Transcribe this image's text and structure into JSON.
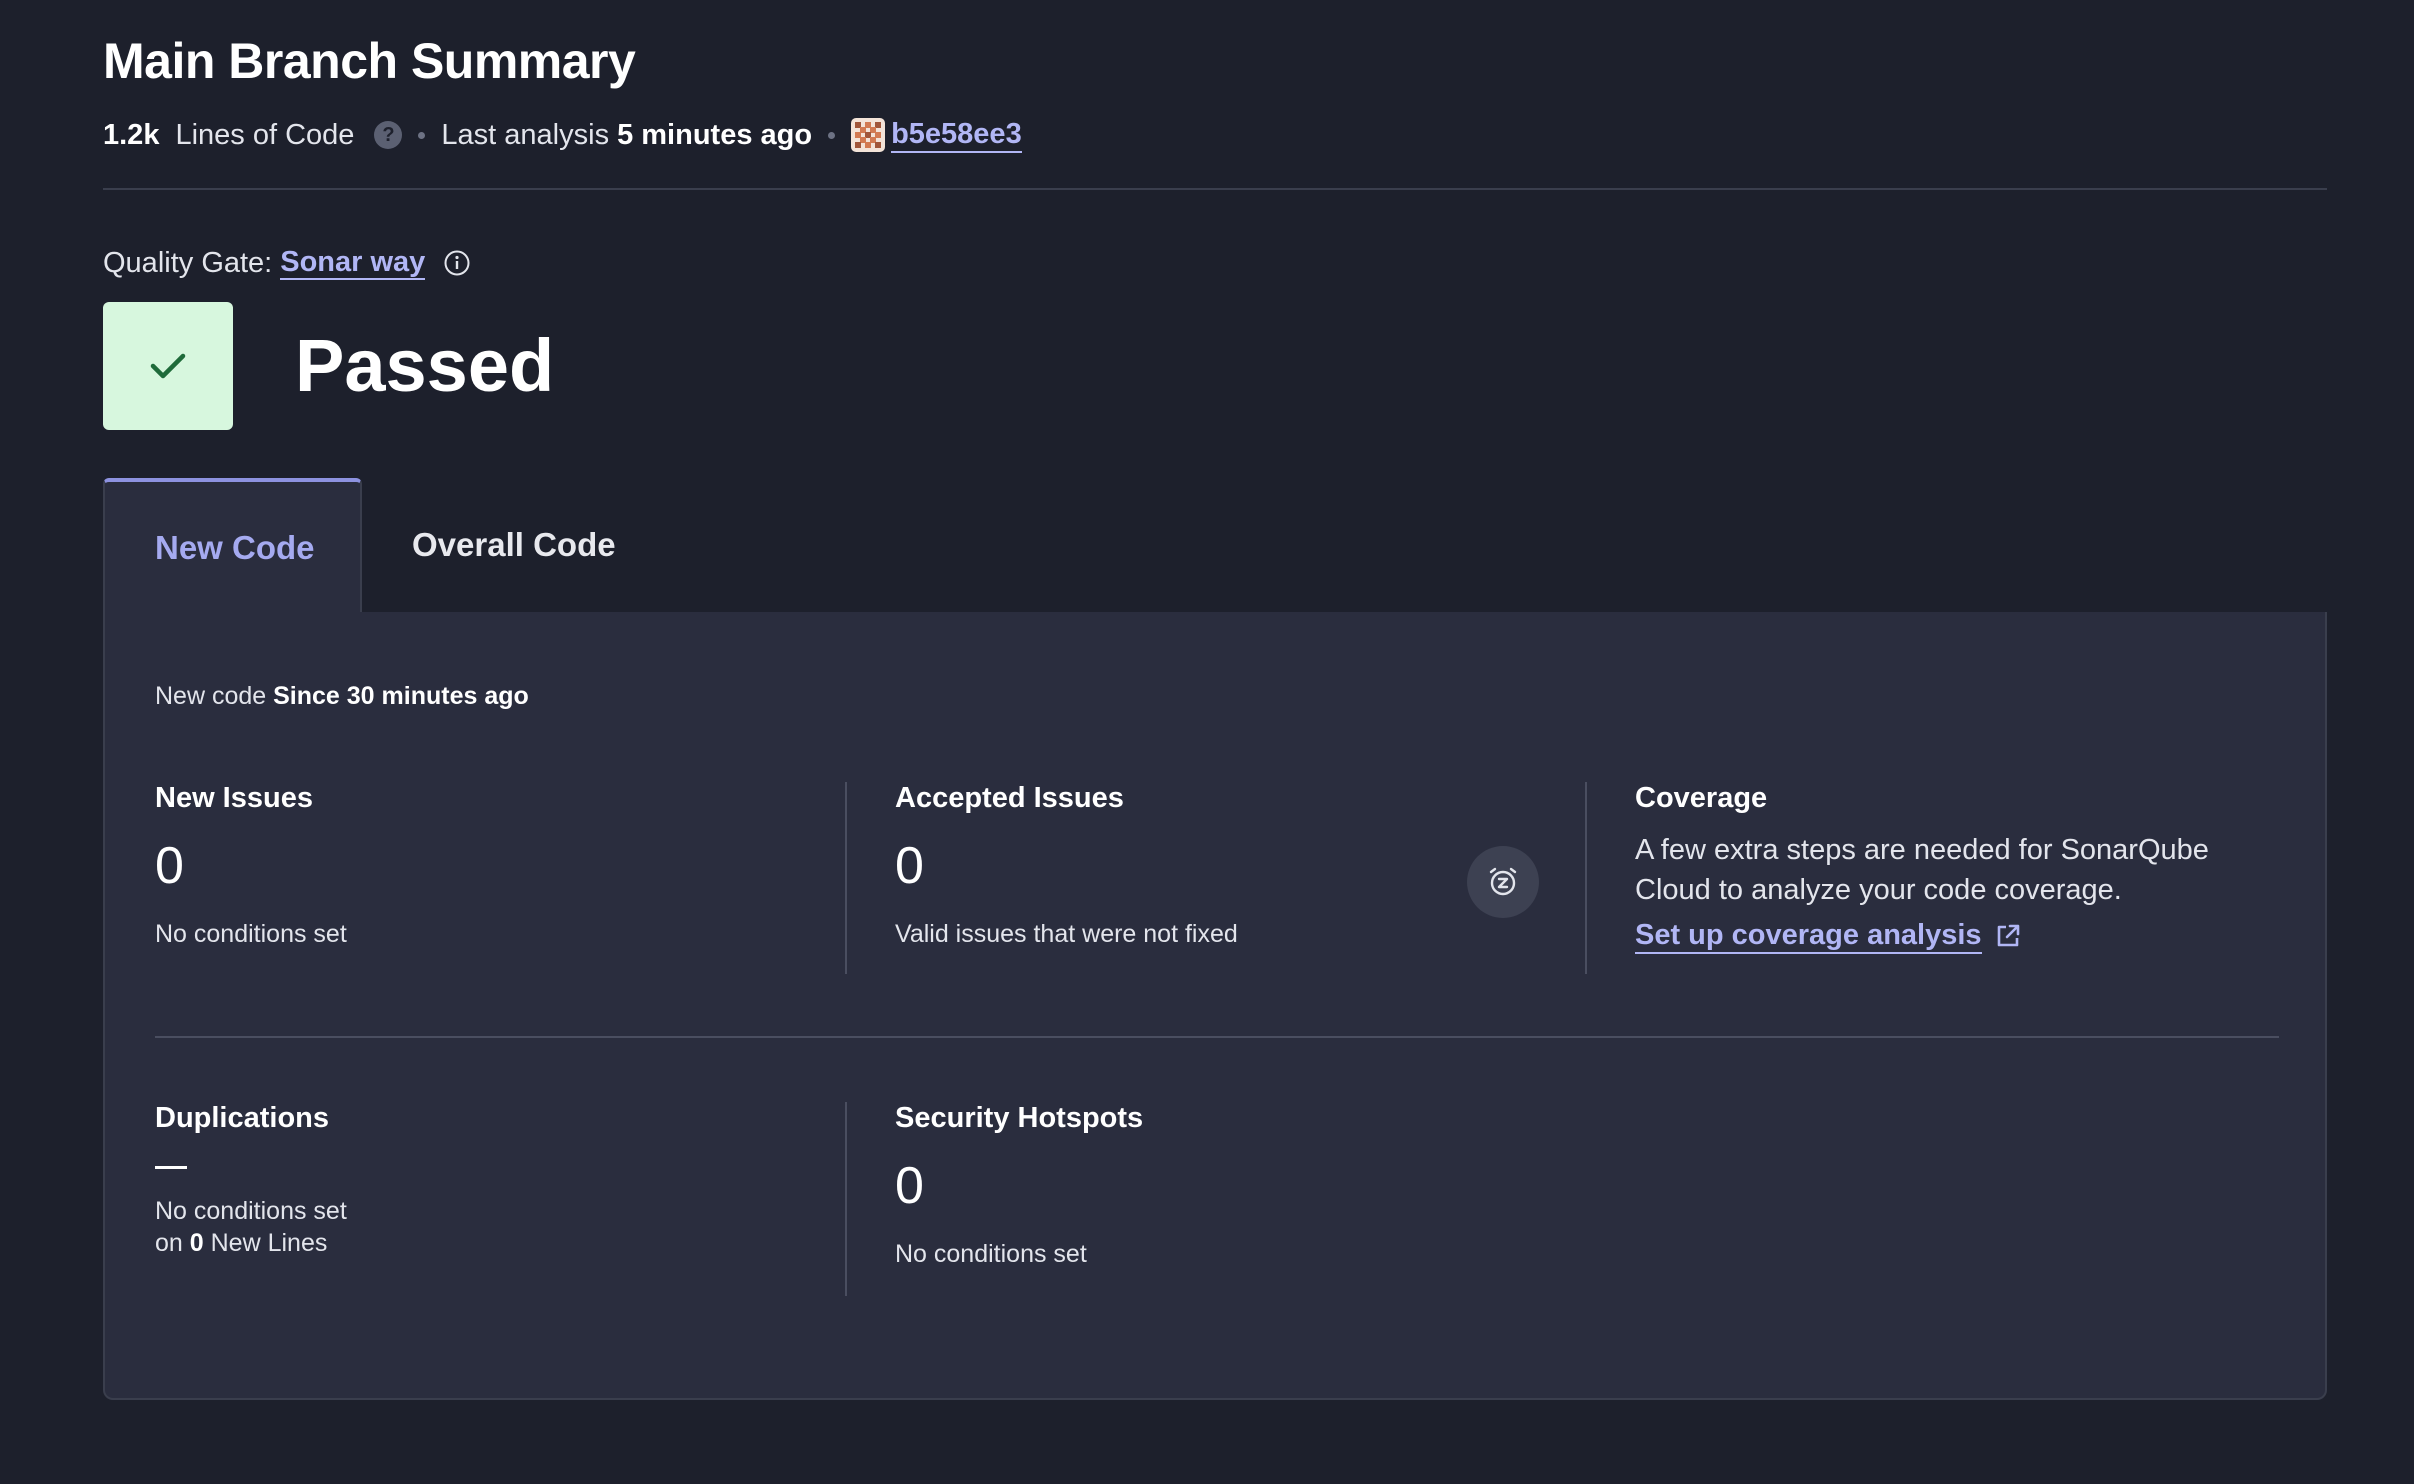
{
  "header": {
    "title": "Main Branch Summary",
    "lines_of_code_value": "1.2k",
    "lines_of_code_label": "Lines of Code",
    "last_analysis_label": "Last analysis",
    "last_analysis_value": "5 minutes ago",
    "commit_hash": "b5e58ee3"
  },
  "quality_gate": {
    "label": "Quality Gate:",
    "name": "Sonar way",
    "status": "Passed",
    "status_color": "#d7f7de"
  },
  "tabs": [
    {
      "label": "New Code",
      "active": true
    },
    {
      "label": "Overall Code",
      "active": false
    }
  ],
  "panel": {
    "new_code_prefix": "New code",
    "new_code_since": "Since 30 minutes ago"
  },
  "metrics": {
    "new_issues": {
      "title": "New Issues",
      "value": "0",
      "sub": "No conditions set"
    },
    "accepted_issues": {
      "title": "Accepted Issues",
      "value": "0",
      "sub": "Valid issues that were not fixed"
    },
    "coverage": {
      "title": "Coverage",
      "description": "A few extra steps are needed for SonarQube Cloud to analyze your code coverage.",
      "link": "Set up coverage analysis"
    },
    "duplications": {
      "title": "Duplications",
      "value": "—",
      "sub_line1": "No conditions set",
      "sub_line2_prefix": "on",
      "sub_line2_value": "0",
      "sub_line2_suffix": "New Lines"
    },
    "security_hotspots": {
      "title": "Security Hotspots",
      "value": "0",
      "sub": "No conditions set"
    }
  },
  "colors": {
    "background": "#1d202c",
    "panel": "#2a2d3e",
    "accent": "#b1b6f5",
    "passed": "#d7f7de"
  }
}
